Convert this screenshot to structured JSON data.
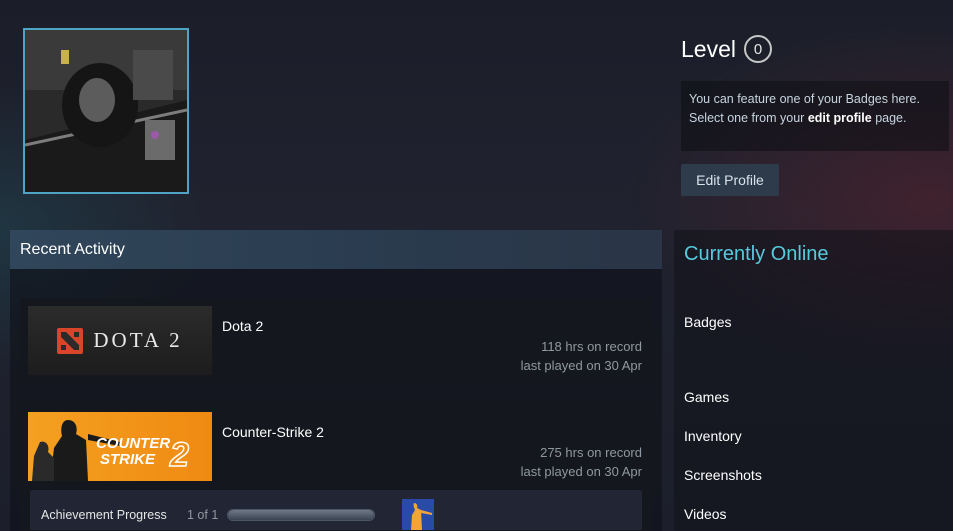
{
  "profile": {
    "level_label": "Level",
    "level_value": "0",
    "badge_text_1": "You can feature one of your Badges here.",
    "badge_text_2a": "Select one from your ",
    "badge_text_2b": "edit profile",
    "badge_text_2c": " page.",
    "edit_button": "Edit Profile"
  },
  "recent": {
    "title": "Recent Activity",
    "games": [
      {
        "name": "Dota 2",
        "logo_text": "DOTA 2",
        "hours": "118 hrs on record",
        "last_played": "last played on 30 Apr"
      },
      {
        "name": "Counter-Strike 2",
        "logo_line1": "COUNTER",
        "logo_line2": "STRIKE",
        "logo_num": "2",
        "hours": "275 hrs on record",
        "last_played": "last played on 30 Apr",
        "achievement": {
          "label": "Achievement Progress",
          "count": "1 of 1",
          "progress": 1.0
        }
      }
    ]
  },
  "sidebar": {
    "status": "Currently Online",
    "links": [
      "Badges",
      "Games",
      "Inventory",
      "Screenshots",
      "Videos"
    ]
  },
  "colors": {
    "accent": "#57cbde",
    "avatar_border": "#4fa3c4",
    "cs_orange": "#f4a020"
  }
}
